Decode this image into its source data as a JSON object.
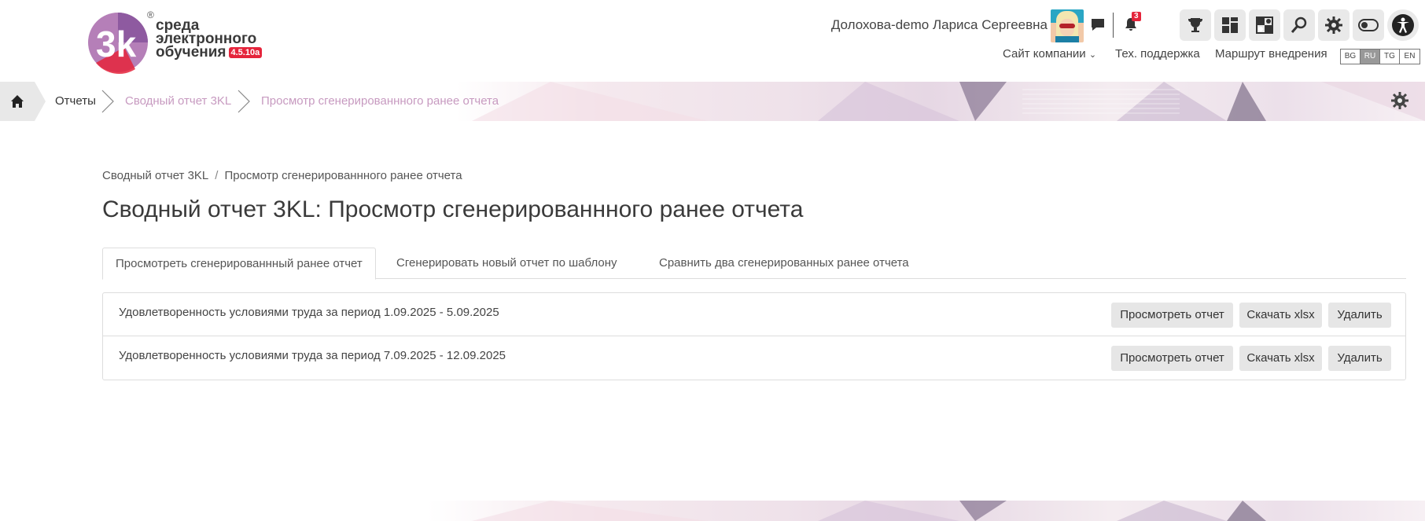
{
  "logo": {
    "line1": "среда",
    "line2": "электронного",
    "line3": "обучения",
    "version": "4.5.10a",
    "mark": "3k",
    "registered": "®"
  },
  "header": {
    "user_name": "Долохова-demo Лариса Сергеевна",
    "notifications_count": "3",
    "nav": {
      "company_site": "Сайт компании",
      "support": "Тех. поддержка",
      "implementation": "Маршрут внедрения"
    },
    "languages": [
      "BG",
      "RU",
      "TG",
      "EN"
    ],
    "active_language": "RU",
    "icons": [
      "chat-icon",
      "bell-icon",
      "trophy-icon",
      "dashboard-icon",
      "chess-icon",
      "search-icon",
      "gear-icon",
      "toggle-icon",
      "accessibility-icon"
    ]
  },
  "breadcrumb_band": {
    "items": [
      "Отчеты",
      "Сводный отчет 3KL",
      "Просмотр сгенерированнного ранее отчета"
    ]
  },
  "content": {
    "breadcrumbs": [
      "Сводный отчет 3KL",
      "Просмотр сгенерированнного ранее отчета"
    ],
    "breadcrumb_sep": "/",
    "title": "Сводный отчет 3KL: Просмотр сгенерированнного ранее отчета",
    "tabs": [
      "Просмотреть сгенерированнный ранее отчет",
      "Сгенерировать новый отчет по шаблону",
      "Сравнить два сгенерированных ранее отчета"
    ],
    "active_tab": 0,
    "reports": [
      {
        "title": "Удовлетворенность условиями труда за период 1.09.2025 - 5.09.2025"
      },
      {
        "title": "Удовлетворенность условиями труда за период 7.09.2025 - 12.09.2025"
      }
    ],
    "actions": {
      "view": "Просмотреть отчет",
      "download": "Скачать xlsx",
      "delete": "Удалить"
    }
  },
  "colors": {
    "accent_pink": "#c79ac0",
    "badge_red": "#e5243b",
    "logo_purple": "#9b5aa3"
  }
}
